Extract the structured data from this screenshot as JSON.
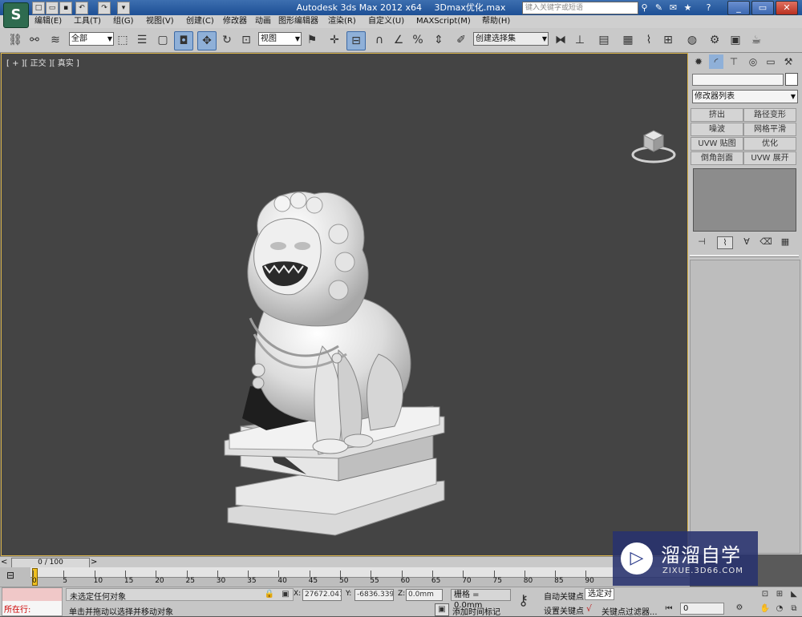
{
  "app": {
    "title_app": "Autodesk 3ds Max  2012 x64",
    "title_file": "3Dmax优化.max",
    "search_placeholder": "键入关键字或短语",
    "logo_glyph": "S",
    "window_controls": [
      "_",
      "▭",
      "✕"
    ]
  },
  "menu": [
    "编辑(E)",
    "工具(T)",
    "组(G)",
    "视图(V)",
    "创建(C)",
    "修改器",
    "动画",
    "图形编辑器",
    "渲染(R)",
    "自定义(U)",
    "MAXScript(M)",
    "帮助(H)"
  ],
  "toolbar": {
    "selection_filter": "全部",
    "reference_coord": "视图",
    "named_selection": "创建选择集"
  },
  "viewport": {
    "label": "[ + ][ 正交 ][ 真实 ]",
    "background": "#444444",
    "border": "#d8b24a"
  },
  "command_panel": {
    "modifier_list": "修改器列表",
    "modifier_buttons": [
      "挤出",
      "路径变形",
      "噪波",
      "网格平滑",
      "UVW 贴图",
      "优化",
      "倒角剖面",
      "UVW 展开"
    ]
  },
  "timeline": {
    "frame_counter": "0 / 100",
    "ticks": [
      "0",
      "5",
      "10",
      "15",
      "20",
      "25",
      "30",
      "35",
      "40",
      "45",
      "50",
      "55",
      "60",
      "65",
      "70",
      "75",
      "80",
      "85",
      "90"
    ],
    "prev_arrow": "<",
    "next_arrow": ">"
  },
  "status": {
    "listener_label": "所在行:",
    "selection_status": "未选定任何对象",
    "prompt": "单击并拖动以选择并移动对象",
    "x_label": "X:",
    "x_value": "27672.041",
    "y_label": "Y:",
    "y_value": "-6836.3396",
    "z_label": "Z:",
    "z_value": "0.0mm",
    "grid": "栅格 = 0.0mm",
    "add_time_tag": "添加时间标记",
    "auto_key": "自动关键点",
    "set_key": "设置关键点",
    "selected_dropdown": "选定对象",
    "key_filters": "关键点过滤器...",
    "frame_field": "0"
  },
  "watermark": {
    "title": "溜溜自学",
    "url": "ZIXUE.3D66.COM"
  }
}
